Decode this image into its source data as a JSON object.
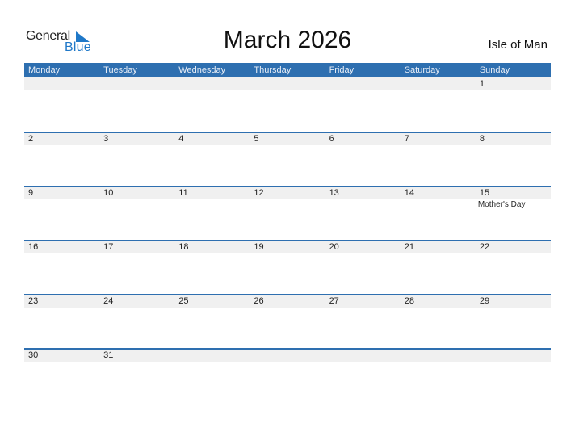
{
  "logo": {
    "general": "General",
    "blue": "Blue",
    "color": "#1f78c8"
  },
  "title": "March 2026",
  "region": "Isle of Man",
  "colors": {
    "header_bg": "#2e6fb0",
    "band_bg": "#f0f0f0"
  },
  "weekdays": [
    "Monday",
    "Tuesday",
    "Wednesday",
    "Thursday",
    "Friday",
    "Saturday",
    "Sunday"
  ],
  "weeks": [
    {
      "days": [
        {
          "num": ""
        },
        {
          "num": ""
        },
        {
          "num": ""
        },
        {
          "num": ""
        },
        {
          "num": ""
        },
        {
          "num": ""
        },
        {
          "num": "1"
        }
      ]
    },
    {
      "days": [
        {
          "num": "2"
        },
        {
          "num": "3"
        },
        {
          "num": "4"
        },
        {
          "num": "5"
        },
        {
          "num": "6"
        },
        {
          "num": "7"
        },
        {
          "num": "8"
        }
      ]
    },
    {
      "days": [
        {
          "num": "9"
        },
        {
          "num": "10"
        },
        {
          "num": "11"
        },
        {
          "num": "12"
        },
        {
          "num": "13"
        },
        {
          "num": "14"
        },
        {
          "num": "15",
          "event": "Mother's Day"
        }
      ]
    },
    {
      "days": [
        {
          "num": "16"
        },
        {
          "num": "17"
        },
        {
          "num": "18"
        },
        {
          "num": "19"
        },
        {
          "num": "20"
        },
        {
          "num": "21"
        },
        {
          "num": "22"
        }
      ]
    },
    {
      "days": [
        {
          "num": "23"
        },
        {
          "num": "24"
        },
        {
          "num": "25"
        },
        {
          "num": "26"
        },
        {
          "num": "27"
        },
        {
          "num": "28"
        },
        {
          "num": "29"
        }
      ]
    },
    {
      "days": [
        {
          "num": "30"
        },
        {
          "num": "31"
        },
        {
          "num": ""
        },
        {
          "num": ""
        },
        {
          "num": ""
        },
        {
          "num": ""
        },
        {
          "num": ""
        }
      ]
    }
  ]
}
